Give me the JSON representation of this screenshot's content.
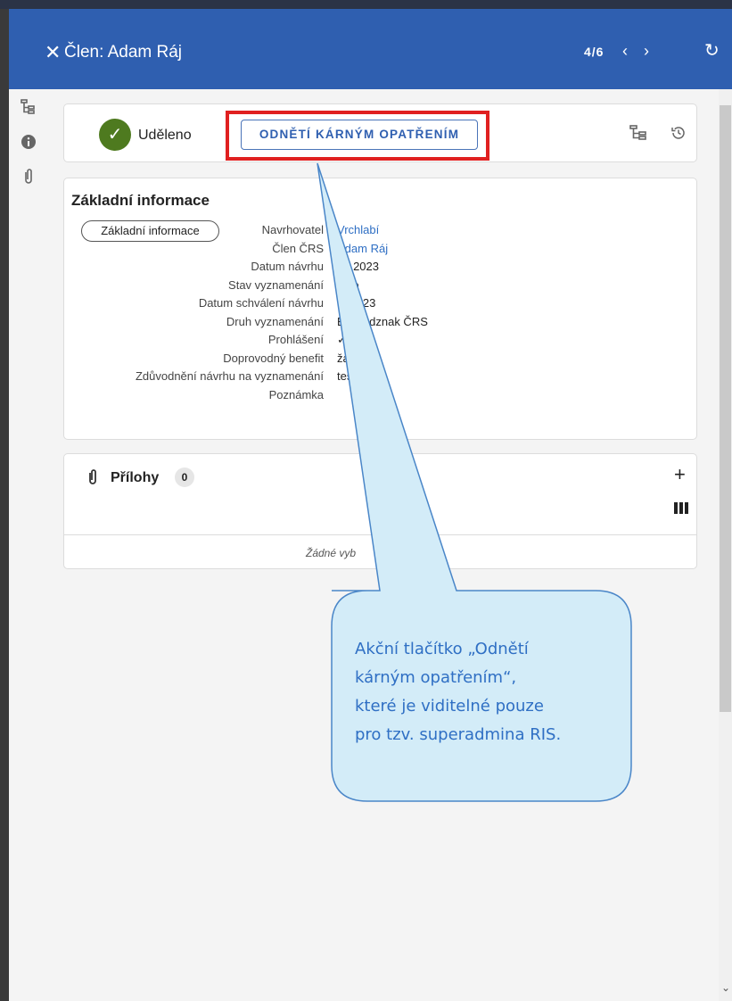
{
  "header": {
    "title": "Člen: Adam Ráj",
    "pager": "4/6",
    "close_glyph": "✕",
    "prev_glyph": "‹",
    "next_glyph": "›",
    "refresh_glyph": "↻",
    "color": "#2f5fb0"
  },
  "status": {
    "label": "Uděleno",
    "check_glyph": "✓",
    "color": "#4e7a1f",
    "action_button": "ODNĚTÍ KÁRNÝM OPATŘENÍM"
  },
  "basic_info": {
    "title": "Základní informace",
    "chip": "Základní informace",
    "fields": [
      {
        "label": "Navrhovatel",
        "value": "Vrchlabí",
        "link": true
      },
      {
        "label": "Člen ČRS",
        "value": "Adam Ráj",
        "link": true
      },
      {
        "label": "Datum návrhu",
        "value": "08.2023",
        "link": false
      },
      {
        "label": "Stav vyznamenání",
        "value": "leno",
        "link": false
      },
      {
        "label": "Datum schválení návrhu",
        "value": "0  .2023",
        "link": false
      },
      {
        "label": "Druh vyznamenání",
        "value": "B      vý odznak ČRS",
        "link": false
      },
      {
        "label": "Prohlášení",
        "value": "✓",
        "link": false
      },
      {
        "label": "Doprovodný benefit",
        "value": "žá",
        "link": false
      },
      {
        "label": "Zdůvodnění návrhu na vyznamenání",
        "value": "tes",
        "link": false
      },
      {
        "label": "Poznámka",
        "value": "",
        "link": false
      }
    ]
  },
  "attachments": {
    "title": "Přílohy",
    "count": "0",
    "empty_text": "Žádné vyb",
    "plus_glyph": "+",
    "columns_glyph": "▮▮▮"
  },
  "callout": {
    "lines": [
      "Akční tlačítko „Odnětí",
      "kárným opatřením“,",
      "které je viditelné pouze",
      "pro tzv. superadmina RIS."
    ],
    "fill": "#d3ecf8",
    "stroke": "#4a86c8"
  },
  "icons": {
    "tree": "tree-icon",
    "info": "info-icon",
    "attachment": "paperclip-icon",
    "history": "history-icon"
  }
}
